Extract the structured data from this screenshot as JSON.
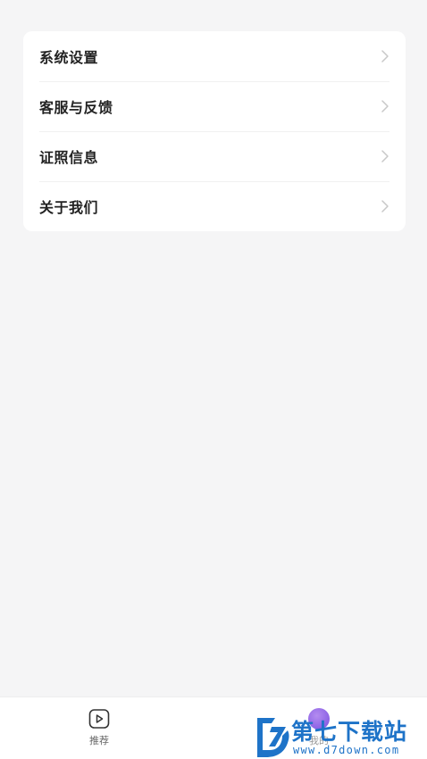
{
  "menu": {
    "items": [
      {
        "label": "系统设置"
      },
      {
        "label": "客服与反馈"
      },
      {
        "label": "证照信息"
      },
      {
        "label": "关于我们"
      }
    ]
  },
  "tabbar": {
    "tabs": [
      {
        "label": "推荐",
        "icon": "play-square-icon"
      },
      {
        "label": "我的",
        "icon": "avatar-icon"
      }
    ]
  },
  "watermark": {
    "title": "第七下载站",
    "url": "www.d7down.com"
  },
  "colors": {
    "background": "#f5f5f6",
    "card": "#ffffff",
    "text": "#222222",
    "chevron": "#c8c8c8",
    "watermark": "#1e73c8"
  }
}
